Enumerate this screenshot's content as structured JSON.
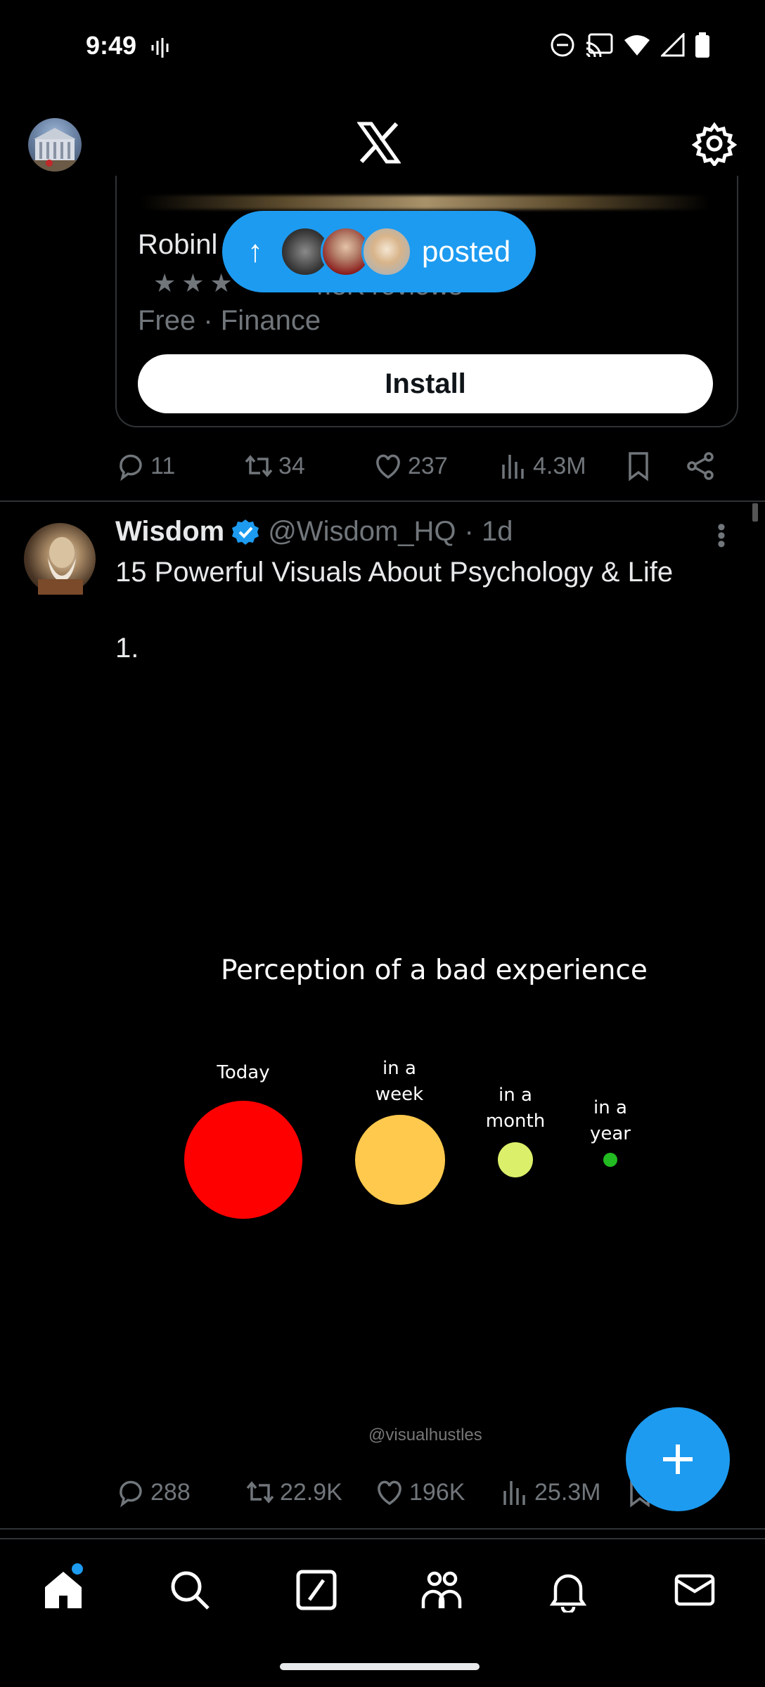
{
  "status_bar": {
    "time": "9:49"
  },
  "header": {
    "logo": "X"
  },
  "ad": {
    "app_name": "Robinhood",
    "app_name_visible": "Robinl",
    "stars": "★★★",
    "reviews": "4.8K reviews",
    "meta": "Free · Finance",
    "install_label": "Install",
    "actions": {
      "replies": "11",
      "reposts": "34",
      "likes": "237",
      "views": "4.3M"
    }
  },
  "posted_pill": {
    "label": "posted"
  },
  "tweet": {
    "name": "Wisdom",
    "handle": "@Wisdom_HQ",
    "time": "· 1d",
    "text": "15 Powerful Visuals About Psychology & Life",
    "list_number": "1.",
    "image": {
      "title": "Perception of a bad experience",
      "credit": "@visualhustles",
      "chart_data": {
        "type": "scatter",
        "title": "Perception of a bad experience",
        "categories": [
          "Today",
          "in a week",
          "in a month",
          "in a year"
        ],
        "relative_size": [
          1.0,
          0.76,
          0.29,
          0.11
        ],
        "colors": [
          "#ff0000",
          "#ffc94d",
          "#dcef6a",
          "#22bb22"
        ]
      }
    },
    "actions": {
      "replies": "288",
      "reposts": "22.9K",
      "likes": "196K",
      "views": "25.3M"
    }
  },
  "nav": [
    "home",
    "search",
    "grok",
    "communities",
    "notifications",
    "messages"
  ]
}
